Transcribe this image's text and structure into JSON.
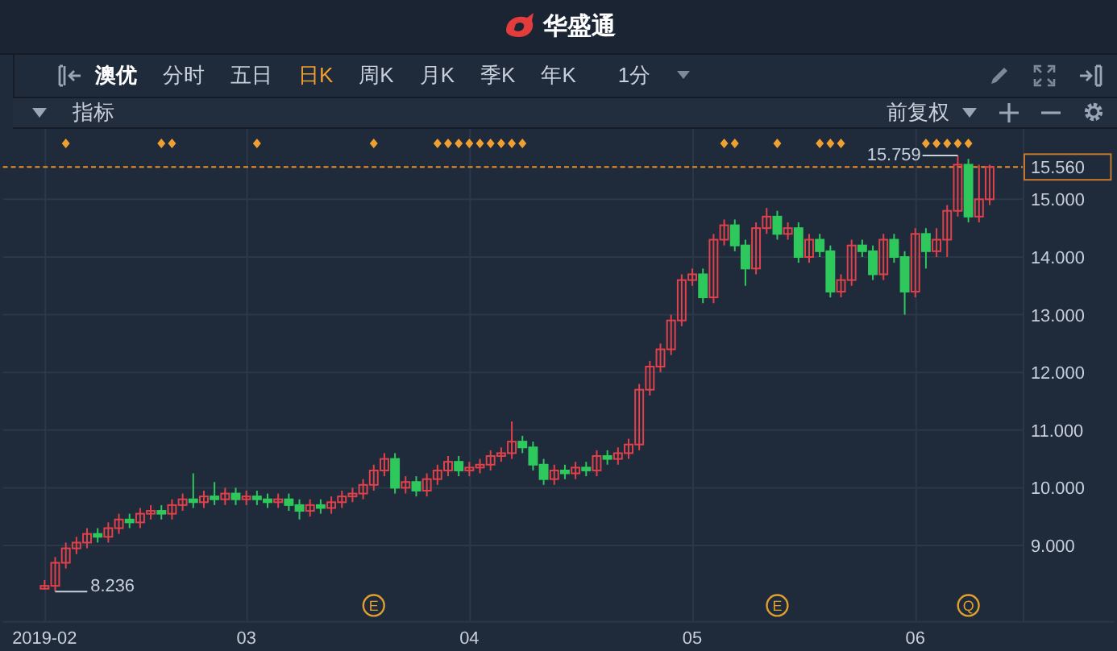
{
  "header": {
    "app_name": "华盛通"
  },
  "toolbar": {
    "stock_name": "澳优",
    "tabs": [
      {
        "label": "分时",
        "selected": false
      },
      {
        "label": "五日",
        "selected": false
      },
      {
        "label": "日K",
        "selected": true
      },
      {
        "label": "周K",
        "selected": false
      },
      {
        "label": "月K",
        "selected": false
      },
      {
        "label": "季K",
        "selected": false
      },
      {
        "label": "年K",
        "selected": false
      }
    ],
    "interval": "1分"
  },
  "indicator_bar": {
    "label": "指标",
    "adjustment": "前复权"
  },
  "chart_data": {
    "type": "candlestick",
    "grid": true,
    "ylim": [
      7.69,
      16.22
    ],
    "yticks": [
      {
        "value": 9,
        "label": "9.000"
      },
      {
        "value": 10,
        "label": "10.000"
      },
      {
        "value": 11,
        "label": "11.000"
      },
      {
        "value": 12,
        "label": "12.000"
      },
      {
        "value": 13,
        "label": "13.000"
      },
      {
        "value": 14,
        "label": "14.000"
      },
      {
        "value": 15,
        "label": "15.000"
      }
    ],
    "categories": [
      "2019-02",
      null,
      null,
      null,
      null,
      null,
      null,
      null,
      null,
      null,
      null,
      null,
      null,
      null,
      null,
      null,
      null,
      null,
      null,
      "03",
      null,
      null,
      null,
      null,
      null,
      null,
      null,
      null,
      null,
      null,
      null,
      null,
      null,
      null,
      null,
      null,
      null,
      null,
      null,
      null,
      "04",
      null,
      null,
      null,
      null,
      null,
      null,
      null,
      null,
      null,
      null,
      null,
      null,
      null,
      null,
      null,
      null,
      null,
      null,
      null,
      null,
      "05",
      null,
      null,
      null,
      null,
      null,
      null,
      null,
      null,
      null,
      null,
      null,
      null,
      null,
      null,
      null,
      null,
      null,
      null,
      null,
      null,
      "06",
      null,
      null,
      null,
      null,
      null,
      null,
      null
    ],
    "ohlc": [
      [
        8.25,
        8.4,
        8.236,
        8.3
      ],
      [
        8.3,
        8.8,
        8.2,
        8.7
      ],
      [
        8.7,
        9.05,
        8.6,
        8.95
      ],
      [
        8.95,
        9.15,
        8.85,
        9.05
      ],
      [
        9.05,
        9.3,
        8.95,
        9.2
      ],
      [
        9.2,
        9.3,
        9.05,
        9.15
      ],
      [
        9.15,
        9.4,
        9.05,
        9.3
      ],
      [
        9.3,
        9.55,
        9.2,
        9.45
      ],
      [
        9.45,
        9.55,
        9.3,
        9.4
      ],
      [
        9.4,
        9.65,
        9.3,
        9.55
      ],
      [
        9.55,
        9.7,
        9.45,
        9.6
      ],
      [
        9.6,
        9.7,
        9.45,
        9.55
      ],
      [
        9.55,
        9.8,
        9.45,
        9.7
      ],
      [
        9.7,
        9.9,
        9.6,
        9.8
      ],
      [
        9.8,
        10.25,
        9.65,
        9.75
      ],
      [
        9.75,
        9.95,
        9.65,
        9.85
      ],
      [
        9.85,
        10.1,
        9.7,
        9.8
      ],
      [
        9.8,
        10,
        9.7,
        9.9
      ],
      [
        9.9,
        10,
        9.7,
        9.8
      ],
      [
        9.8,
        9.95,
        9.7,
        9.85
      ],
      [
        9.85,
        9.95,
        9.7,
        9.8
      ],
      [
        9.8,
        9.9,
        9.65,
        9.75
      ],
      [
        9.75,
        9.9,
        9.65,
        9.8
      ],
      [
        9.8,
        9.9,
        9.6,
        9.7
      ],
      [
        9.7,
        9.8,
        9.45,
        9.6
      ],
      [
        9.6,
        9.8,
        9.5,
        9.7
      ],
      [
        9.7,
        9.8,
        9.55,
        9.65
      ],
      [
        9.65,
        9.85,
        9.55,
        9.75
      ],
      [
        9.75,
        9.95,
        9.65,
        9.85
      ],
      [
        9.85,
        10,
        9.75,
        9.9
      ],
      [
        9.9,
        10.15,
        9.8,
        10.05
      ],
      [
        10.05,
        10.4,
        9.95,
        10.3
      ],
      [
        10.3,
        10.6,
        10.2,
        10.5
      ],
      [
        10.5,
        10.6,
        9.9,
        10
      ],
      [
        10,
        10.2,
        9.9,
        10.1
      ],
      [
        10.1,
        10.2,
        9.85,
        9.95
      ],
      [
        9.95,
        10.25,
        9.85,
        10.15
      ],
      [
        10.15,
        10.4,
        10.05,
        10.3
      ],
      [
        10.3,
        10.55,
        10.2,
        10.45
      ],
      [
        10.45,
        10.55,
        10.2,
        10.3
      ],
      [
        10.3,
        10.45,
        10.2,
        10.35
      ],
      [
        10.35,
        10.5,
        10.25,
        10.4
      ],
      [
        10.4,
        10.65,
        10.3,
        10.55
      ],
      [
        10.55,
        10.7,
        10.45,
        10.6
      ],
      [
        10.6,
        11.15,
        10.5,
        10.8
      ],
      [
        10.8,
        10.9,
        10.6,
        10.7
      ],
      [
        10.7,
        10.8,
        10.3,
        10.4
      ],
      [
        10.4,
        10.5,
        10.05,
        10.15
      ],
      [
        10.15,
        10.4,
        10.05,
        10.3
      ],
      [
        10.3,
        10.4,
        10.15,
        10.25
      ],
      [
        10.25,
        10.45,
        10.15,
        10.35
      ],
      [
        10.35,
        10.45,
        10.2,
        10.3
      ],
      [
        10.3,
        10.65,
        10.2,
        10.55
      ],
      [
        10.55,
        10.65,
        10.4,
        10.5
      ],
      [
        10.5,
        10.7,
        10.4,
        10.6
      ],
      [
        10.6,
        10.85,
        10.5,
        10.75
      ],
      [
        10.75,
        11.8,
        10.65,
        11.7
      ],
      [
        11.7,
        12.2,
        11.6,
        12.1
      ],
      [
        12.1,
        12.5,
        12,
        12.4
      ],
      [
        12.4,
        13,
        12.3,
        12.9
      ],
      [
        12.9,
        13.7,
        12.8,
        13.6
      ],
      [
        13.6,
        13.8,
        13.5,
        13.7
      ],
      [
        13.7,
        13.8,
        13.2,
        13.3
      ],
      [
        13.3,
        14.4,
        13.2,
        14.3
      ],
      [
        14.3,
        14.65,
        14.2,
        14.55
      ],
      [
        14.55,
        14.65,
        14.1,
        14.2
      ],
      [
        14.2,
        14.3,
        13.5,
        13.8
      ],
      [
        13.8,
        14.6,
        13.7,
        14.5
      ],
      [
        14.5,
        14.85,
        14.4,
        14.7
      ],
      [
        14.7,
        14.8,
        14.3,
        14.4
      ],
      [
        14.4,
        14.6,
        14.3,
        14.5
      ],
      [
        14.5,
        14.6,
        13.9,
        14
      ],
      [
        14,
        14.4,
        13.9,
        14.3
      ],
      [
        14.3,
        14.4,
        14,
        14.1
      ],
      [
        14.1,
        14.2,
        13.3,
        13.4
      ],
      [
        13.4,
        13.7,
        13.3,
        13.6
      ],
      [
        13.6,
        14.3,
        13.5,
        14.2
      ],
      [
        14.2,
        14.3,
        14,
        14.1
      ],
      [
        14.1,
        14.2,
        13.6,
        13.7
      ],
      [
        13.7,
        14.4,
        13.6,
        14.3
      ],
      [
        14.3,
        14.4,
        13.9,
        14
      ],
      [
        14,
        14.1,
        13,
        13.4
      ],
      [
        13.4,
        14.5,
        13.3,
        14.4
      ],
      [
        14.4,
        14.5,
        13.8,
        14.1
      ],
      [
        14.1,
        14.5,
        14,
        14.3
      ],
      [
        14.3,
        14.9,
        14,
        14.8
      ],
      [
        14.8,
        15.759,
        14.7,
        15.6
      ],
      [
        15.6,
        15.7,
        14.6,
        14.7
      ],
      [
        14.7,
        15.6,
        14.6,
        15
      ],
      [
        15,
        15.6,
        14.9,
        15.56
      ]
    ],
    "ref_lines": [
      {
        "axis": "y",
        "value": 15.56,
        "label": "15.560"
      }
    ],
    "annotations": [
      {
        "text": "15.759"
      },
      {
        "text": "8.236"
      },
      {
        "text": "E"
      },
      {
        "text": "E"
      },
      {
        "text": "Q"
      }
    ]
  }
}
